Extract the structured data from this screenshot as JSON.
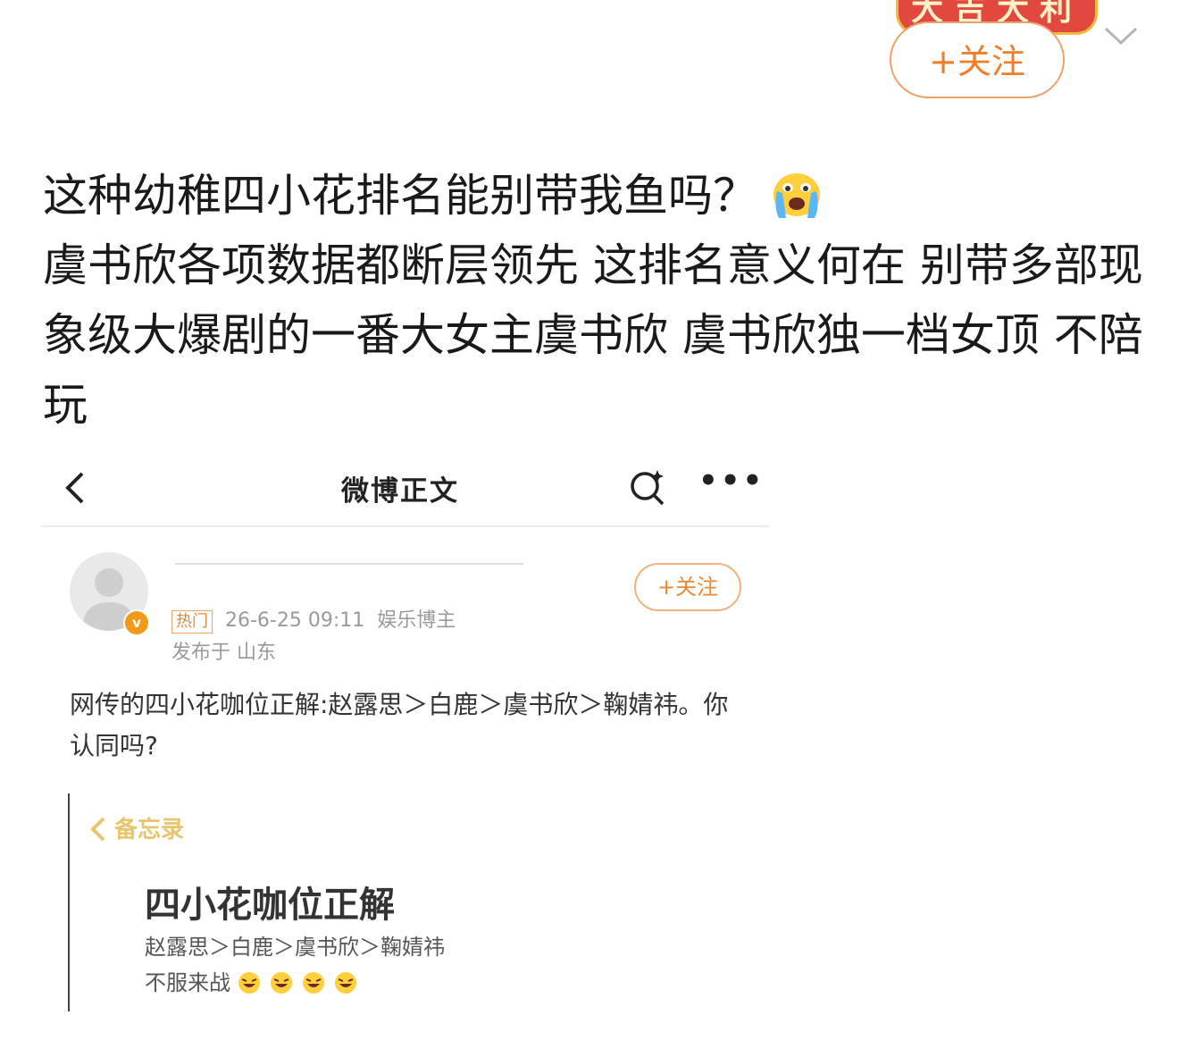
{
  "header": {
    "badge_text": "大吉大利",
    "follow_label": "+关注",
    "chevron_icon": "chevron-down-icon",
    "accent_color": "#f07d28"
  },
  "post": {
    "line1": "这种幼稚四小花排名能别带我鱼吗？",
    "line1_emoji": "crying-face-emoji",
    "body": "虞书欣各项数据都断层领先 这排名意义何在 别带多部现象级大爆剧的一番大女主虞书欣 虞书欣独一档女顶 不陪玩"
  },
  "embedded": {
    "nav_title": "微博正文",
    "follow_label": "+关注",
    "hot_tag": "热门",
    "date": "26-6-25 09:11",
    "author_type": "娱乐博主",
    "location": "发布于 山东",
    "verified_badge": "v",
    "text": "网传的四小花咖位正解:赵露思＞白鹿＞虞书欣＞鞠婧祎。你认同吗?",
    "memo": {
      "back_label": "备忘录",
      "title": "四小花咖位正解",
      "line1": "赵露思＞白鹿＞虞书欣＞鞠婧祎",
      "line2": "不服来战"
    }
  }
}
